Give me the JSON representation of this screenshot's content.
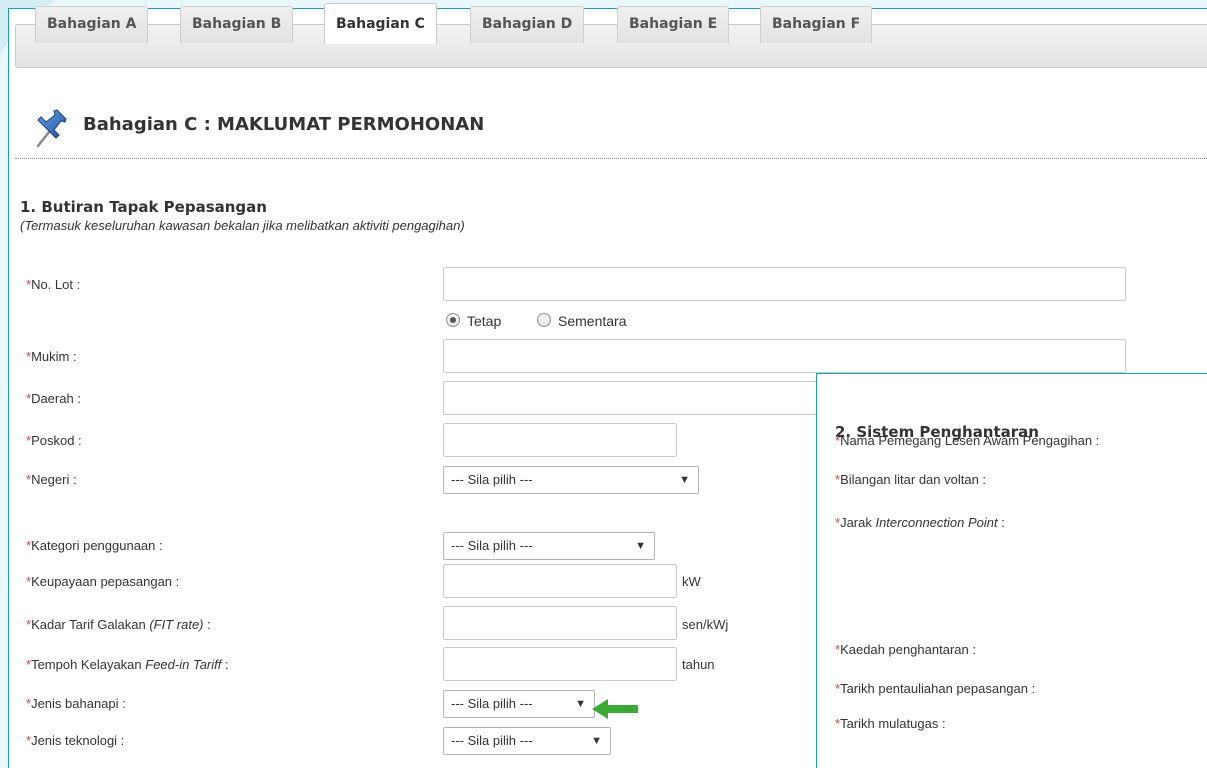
{
  "colors": {
    "accent": "#19a0a8",
    "required": "#e04040",
    "arrow": "#3aa935"
  },
  "tabs": [
    {
      "label": "Bahagian A",
      "active": false
    },
    {
      "label": "Bahagian B",
      "active": false
    },
    {
      "label": "Bahagian C",
      "active": true
    },
    {
      "label": "Bahagian D",
      "active": false
    },
    {
      "label": "Bahagian E",
      "active": false
    },
    {
      "label": "Bahagian F",
      "active": false
    }
  ],
  "page": {
    "title": "Bahagian C : MAKLUMAT PERMOHONAN",
    "icon": "pushpin-icon"
  },
  "section1": {
    "title": "1. Butiran Tapak Pepasangan",
    "subtitle": "(Termasuk keseluruhan kawasan bekalan jika melibatkan aktiviti pengagihan)",
    "fields": {
      "no_lot": {
        "label": "No. Lot :",
        "value": ""
      },
      "lot_type": {
        "options": [
          "Tetap",
          "Sementara"
        ],
        "selected": "Tetap"
      },
      "mukim": {
        "label": "Mukim :",
        "value": ""
      },
      "daerah": {
        "label": "Daerah :",
        "value": ""
      },
      "poskod": {
        "label": "Poskod :",
        "value": ""
      },
      "negeri": {
        "label": "Negeri :",
        "selected": "--- Sila pilih ---"
      },
      "kategori": {
        "label": "Kategori penggunaan :",
        "selected": "--- Sila pilih ---"
      },
      "keupayaan": {
        "label": "Keupayaan pepasangan :",
        "value": "",
        "unit": "kW"
      },
      "kadar_prefix": "Kadar Tarif Galakan ",
      "kadar_italic": "(FIT rate)",
      "kadar_suffix": " :",
      "kadar_unit": "sen/kWj",
      "tempoh_prefix": "Tempoh Kelayakan ",
      "tempoh_italic": "Feed-in Tariff",
      "tempoh_suffix": " :",
      "tempoh_unit": "tahun",
      "bahanapi": {
        "label": "Jenis bahanapi :",
        "selected": "--- Sila pilih ---"
      },
      "teknologi": {
        "label": "Jenis teknologi :",
        "selected": "--- Sila pilih ---"
      }
    }
  },
  "section2": {
    "title": "2. Sistem Penghantaran",
    "nama_pemegang": "Nama Pemegang Lesen Awam Pengagihan :",
    "bilangan_litar": "Bilangan litar dan voltan :",
    "jarak_prefix": "Jarak ",
    "jarak_italic": "Interconnection Point",
    "jarak_suffix": " :",
    "kaedah": "Kaedah penghantaran :",
    "tarikh_pentauliahan": "Tarikh pentauliahan pepasangan :",
    "tarikh_mulatugas": "Tarikh mulatugas :"
  },
  "required_mark": "*",
  "dropdown_caret": "▼"
}
